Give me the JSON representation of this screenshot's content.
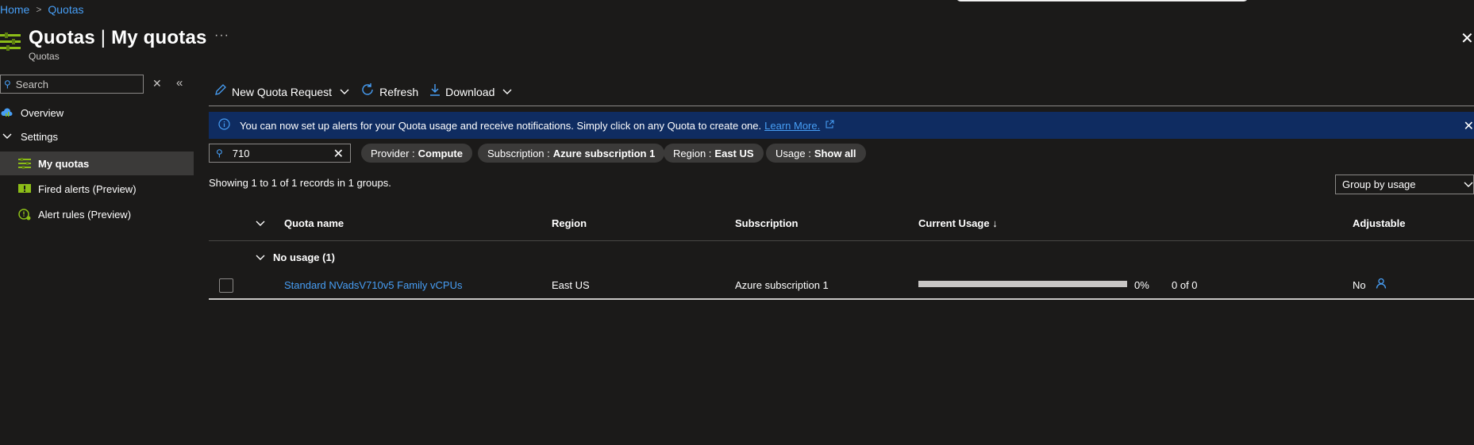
{
  "breadcrumb": {
    "home": "Home",
    "current": "Quotas"
  },
  "header": {
    "title": "Quotas",
    "title_sep": " | ",
    "title_section": "My quotas",
    "subtitle": "Quotas",
    "more": "···"
  },
  "sidebar": {
    "search_placeholder": "Search",
    "items": [
      {
        "label": "Overview",
        "icon": "cloud-overview-icon"
      },
      {
        "label": "Settings",
        "icon": "chevron-down-icon"
      },
      {
        "label": "My quotas",
        "icon": "quotas-icon",
        "selected": true
      },
      {
        "label": "Fired alerts (Preview)",
        "icon": "alert-icon"
      },
      {
        "label": "Alert rules (Preview)",
        "icon": "alert-rule-icon"
      }
    ]
  },
  "toolbar": {
    "new_request": "New Quota Request",
    "refresh": "Refresh",
    "download": "Download"
  },
  "banner": {
    "text": "You can now set up alerts for your Quota usage and receive notifications. Simply click on any Quota to create one.",
    "link": "Learn More."
  },
  "filters": {
    "search_value": "710",
    "provider_label": "Provider :",
    "provider_value": "Compute",
    "subscription_label": "Subscription :",
    "subscription_value": "Azure subscription 1",
    "region_label": "Region :",
    "region_value": "East US",
    "usage_label": "Usage :",
    "usage_value": "Show all"
  },
  "summary": "Showing 1 to 1 of 1 records in 1 groups.",
  "group_by": "Group by usage",
  "table": {
    "columns": [
      "Quota name",
      "Region",
      "Subscription",
      "Current Usage ↓",
      "Adjustable"
    ],
    "groups": [
      {
        "label": "No usage (1)",
        "rows": [
          {
            "name": "Standard NVadsV710v5 Family vCPUs",
            "region": "East US",
            "subscription": "Azure subscription 1",
            "usage_percent": "0%",
            "usage_fraction": 0,
            "usage_count": "0 of 0",
            "adjustable": "No"
          }
        ]
      }
    ]
  },
  "colors": {
    "accent": "#479ef5",
    "banner": "#0f2c61",
    "background": "#1b1a19",
    "selected": "#3b3a39"
  }
}
